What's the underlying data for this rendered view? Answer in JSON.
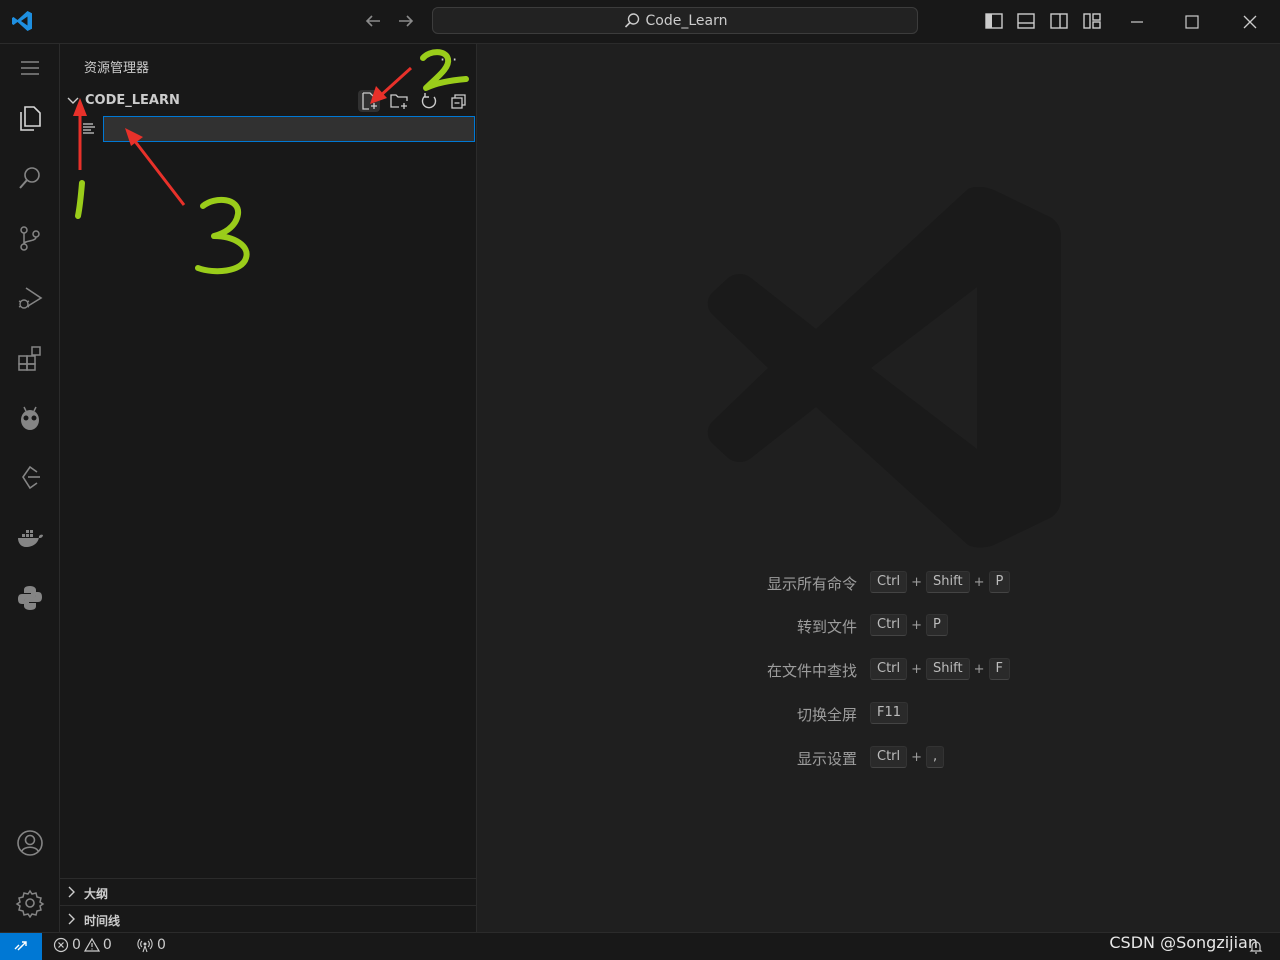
{
  "titlebar": {
    "search_text": "Code_Learn"
  },
  "activity_bar": {
    "items": [
      "explorer-icon",
      "search-icon",
      "source-control-icon",
      "run-debug-icon",
      "extensions-icon",
      "platformio-icon",
      "remote-icon",
      "docker-icon",
      "python-icon"
    ],
    "bottom": [
      "accounts-icon",
      "settings-gear-icon"
    ]
  },
  "sidebar": {
    "title": "资源管理器",
    "more": "···",
    "folder": "CODE_LEARN",
    "new_file_value": "",
    "sections": [
      "大纲",
      "时间线"
    ]
  },
  "editor": {
    "shortcuts": [
      {
        "label": "显示所有命令",
        "keys": [
          "Ctrl",
          "Shift",
          "P"
        ]
      },
      {
        "label": "转到文件",
        "keys": [
          "Ctrl",
          "P"
        ]
      },
      {
        "label": "在文件中查找",
        "keys": [
          "Ctrl",
          "Shift",
          "F"
        ]
      },
      {
        "label": "切换全屏",
        "keys": [
          "F11"
        ]
      },
      {
        "label": "显示设置",
        "keys": [
          "Ctrl",
          ","
        ]
      }
    ]
  },
  "statusbar": {
    "errors": "0",
    "warnings": "0",
    "ports": "0",
    "watermark": "CSDN @Songzijian"
  },
  "annotations": {
    "labels": [
      "1",
      "2",
      "3"
    ],
    "color": "#9acd1a",
    "arrow_color": "#e8312a"
  },
  "colors": {
    "accent": "#0078d4",
    "background": "#1f1f1f",
    "sidebar": "#181818"
  }
}
